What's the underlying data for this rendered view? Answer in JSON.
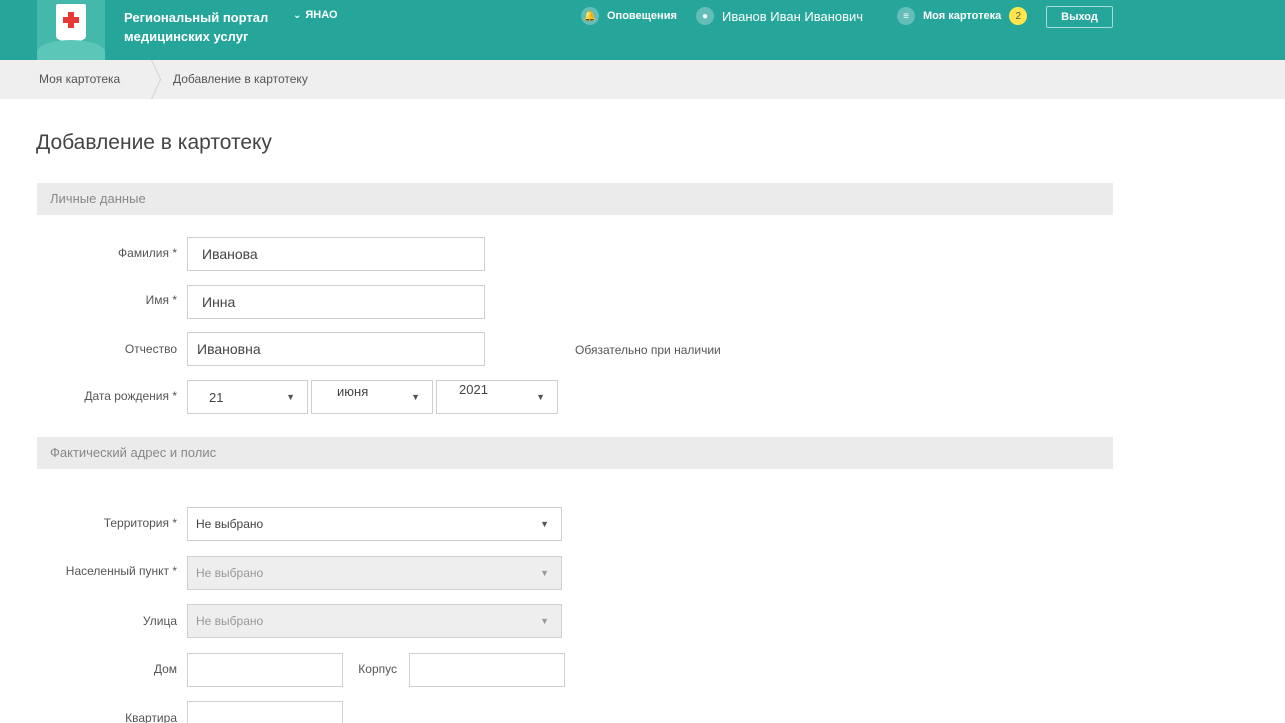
{
  "header": {
    "portal_title": "Региональный портал медицинских услуг",
    "region": "ЯНАО",
    "notifications": "Оповещения",
    "user_name": "Иванов Иван Иванович",
    "my_cards": "Моя картотека",
    "cards_badge": "2",
    "logout": "Выход"
  },
  "breadcrumb": {
    "items": [
      "Моя картотека",
      "Добавление в картотеку"
    ]
  },
  "page": {
    "title": "Добавление в картотеку"
  },
  "personal": {
    "section_title": "Личные данные",
    "surname_label": "Фамилия *",
    "surname_value": "Иванова",
    "name_label": "Имя *",
    "name_value": "Инна",
    "patronymic_label": "Отчество",
    "patronymic_value": "Ивановна",
    "patronymic_hint": "Обязательно при наличии",
    "birth_label": "Дата рождения *",
    "birth_day": "21",
    "birth_month": "июня",
    "birth_year": "2021"
  },
  "address": {
    "section_title": "Фактический адрес и полис",
    "territory_label": "Территория *",
    "territory_value": "Не выбрано",
    "settlement_label": "Населенный пункт *",
    "settlement_value": "Не выбрано",
    "street_label": "Улица",
    "street_value": "Не выбрано",
    "house_label": "Дом",
    "building_label": "Корпус",
    "apartment_label": "Квартира"
  },
  "colors": {
    "header": "#26a69a",
    "badge": "#ffe74c",
    "cross": "#e53935"
  }
}
